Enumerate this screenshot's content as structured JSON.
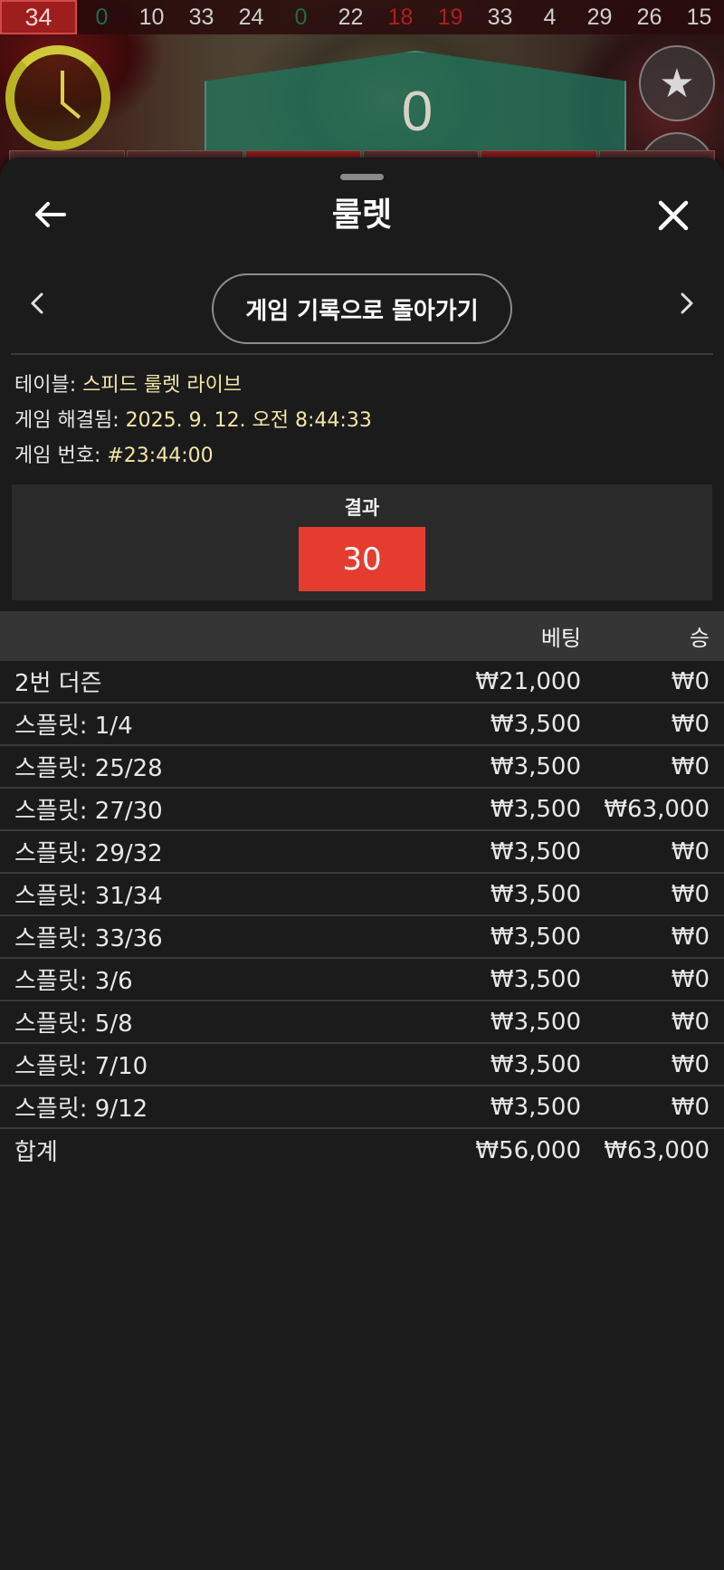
{
  "history": {
    "latest": "34",
    "numbers": [
      {
        "v": "0",
        "c": "green"
      },
      {
        "v": "10",
        "c": "black"
      },
      {
        "v": "33",
        "c": "black"
      },
      {
        "v": "24",
        "c": "black"
      },
      {
        "v": "0",
        "c": "green"
      },
      {
        "v": "22",
        "c": "black"
      },
      {
        "v": "18",
        "c": "red"
      },
      {
        "v": "19",
        "c": "red"
      },
      {
        "v": "33",
        "c": "black"
      },
      {
        "v": "4",
        "c": "black"
      },
      {
        "v": "29",
        "c": "black"
      },
      {
        "v": "26",
        "c": "black"
      },
      {
        "v": "15",
        "c": "black"
      }
    ]
  },
  "game": {
    "wheel_value": "0",
    "timer_icon": "clock-icon",
    "favorite_icon": "star-icon"
  },
  "sheet": {
    "title": "룰렛",
    "history_button": "게임 기록으로 돌아가기",
    "info": {
      "table_label": "테이블:",
      "table_value": "스피드 룰렛 라이브",
      "resolved_label": "게임 해결됨:",
      "resolved_value": "2025. 9. 12. 오전 8:44:33",
      "number_label": "게임 번호:",
      "number_value": "#23:44:00"
    },
    "result": {
      "label": "결과",
      "value": "30",
      "color": "#e43d2f"
    }
  },
  "bets": {
    "header": {
      "name": "",
      "bet": "베팅",
      "win": "승"
    },
    "rows": [
      {
        "name": "2번 더즌",
        "bet": "₩21,000",
        "win": "₩0"
      },
      {
        "name": "스플릿: 1/4",
        "bet": "₩3,500",
        "win": "₩0"
      },
      {
        "name": "스플릿: 25/28",
        "bet": "₩3,500",
        "win": "₩0"
      },
      {
        "name": "스플릿: 27/30",
        "bet": "₩3,500",
        "win": "₩63,000"
      },
      {
        "name": "스플릿: 29/32",
        "bet": "₩3,500",
        "win": "₩0"
      },
      {
        "name": "스플릿: 31/34",
        "bet": "₩3,500",
        "win": "₩0"
      },
      {
        "name": "스플릿: 33/36",
        "bet": "₩3,500",
        "win": "₩0"
      },
      {
        "name": "스플릿: 3/6",
        "bet": "₩3,500",
        "win": "₩0"
      },
      {
        "name": "스플릿: 5/8",
        "bet": "₩3,500",
        "win": "₩0"
      },
      {
        "name": "스플릿: 7/10",
        "bet": "₩3,500",
        "win": "₩0"
      },
      {
        "name": "스플릿: 9/12",
        "bet": "₩3,500",
        "win": "₩0"
      }
    ],
    "total": {
      "name": "합계",
      "bet": "₩56,000",
      "win": "₩63,000"
    }
  }
}
